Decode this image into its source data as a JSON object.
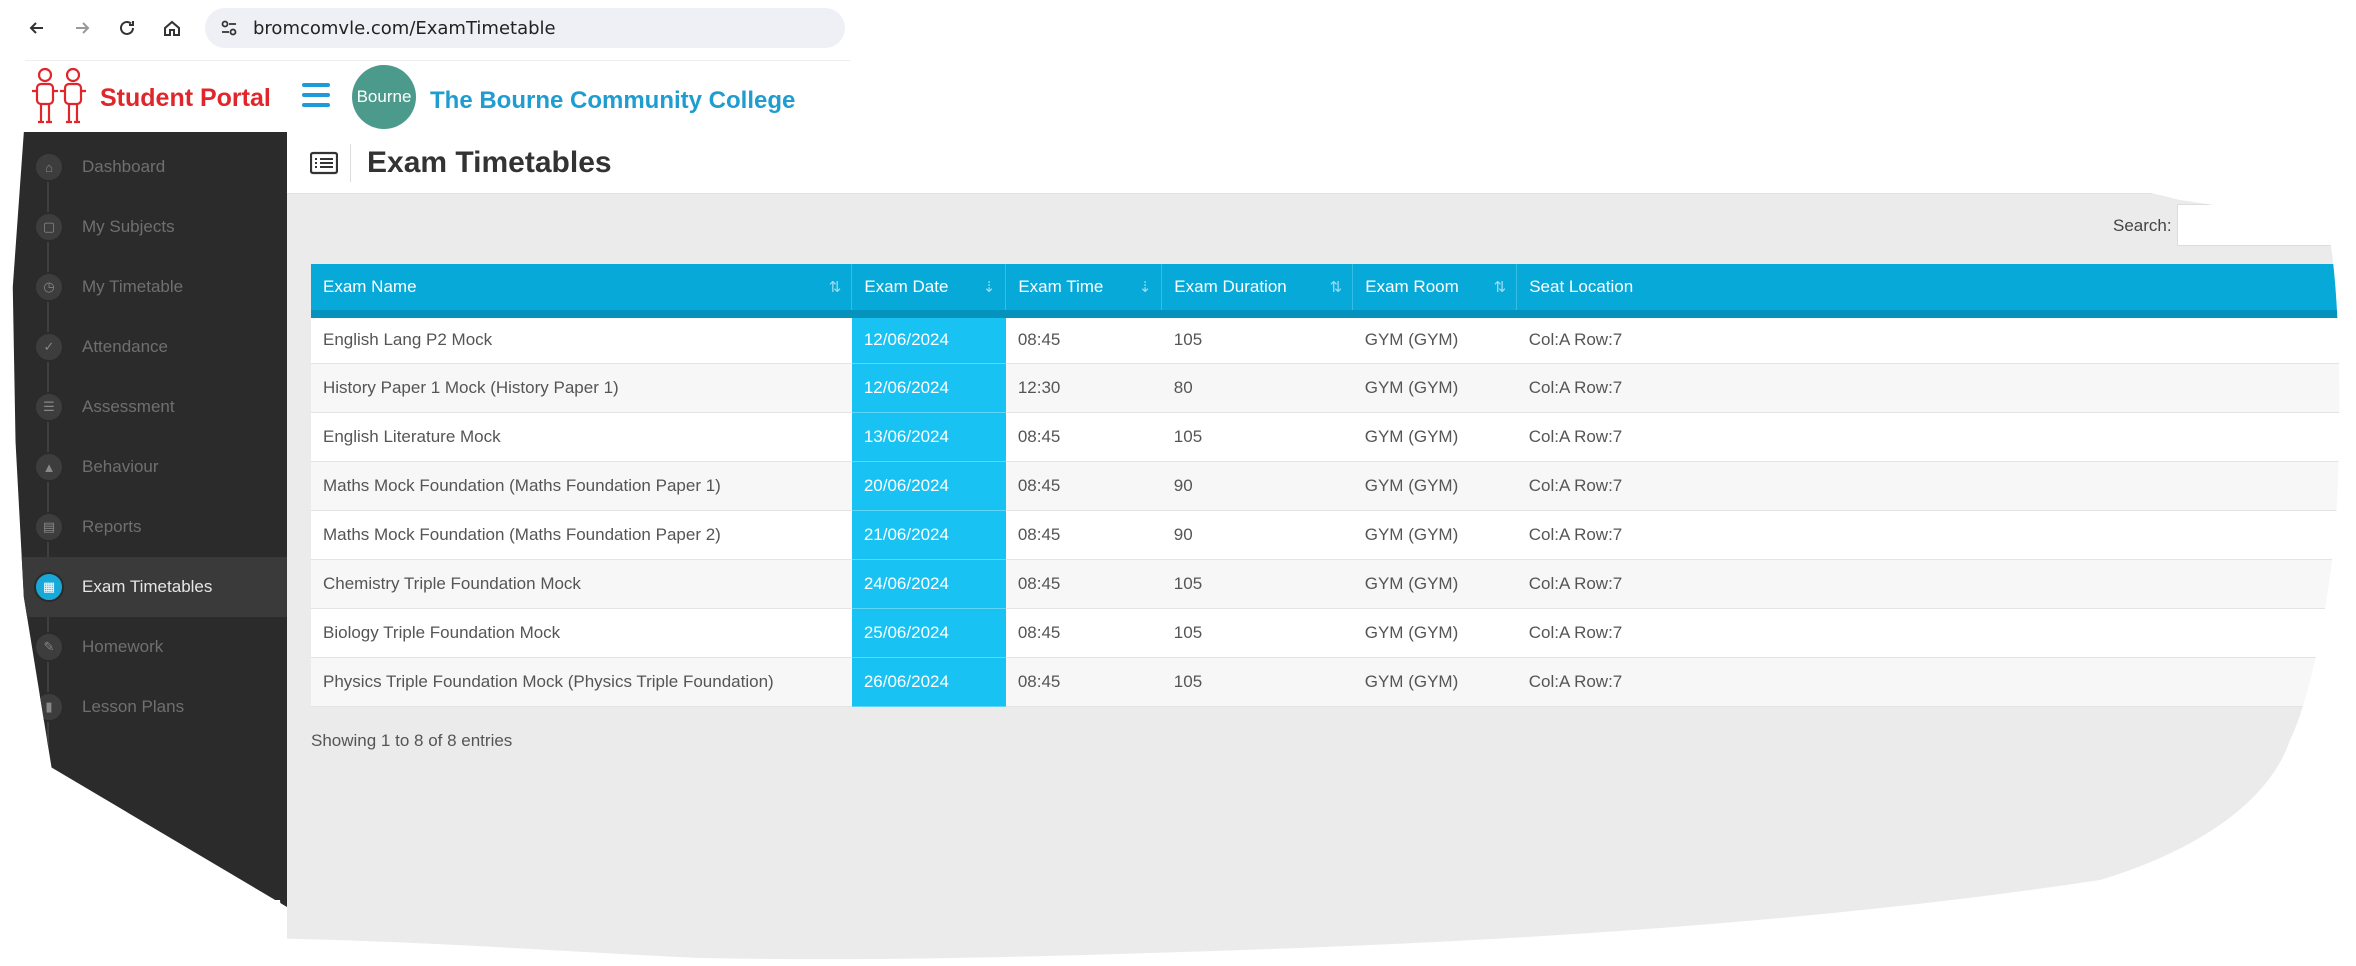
{
  "browser": {
    "url": "bromcomvle.com/ExamTimetable"
  },
  "header": {
    "portal_title": "Student Portal",
    "college_logo_text": "Bourne",
    "college_name": "The Bourne Community College"
  },
  "sidebar": {
    "items": [
      {
        "label": "Dashboard",
        "icon": "home-icon",
        "glyph": "⌂"
      },
      {
        "label": "My Subjects",
        "icon": "document-icon",
        "glyph": "▢"
      },
      {
        "label": "My Timetable",
        "icon": "clock-icon",
        "glyph": "◷"
      },
      {
        "label": "Attendance",
        "icon": "check-icon",
        "glyph": "✓"
      },
      {
        "label": "Assessment",
        "icon": "list-icon",
        "glyph": "☰"
      },
      {
        "label": "Behaviour",
        "icon": "graduation-cap-icon",
        "glyph": "▲"
      },
      {
        "label": "Reports",
        "icon": "report-icon",
        "glyph": "▤"
      },
      {
        "label": "Exam Timetables",
        "icon": "calendar-icon",
        "glyph": "▦"
      },
      {
        "label": "Homework",
        "icon": "pencil-icon",
        "glyph": "✎"
      },
      {
        "label": "Lesson Plans",
        "icon": "book-icon",
        "glyph": "▮"
      }
    ],
    "active_index": 7
  },
  "main": {
    "page_title": "Exam Timetables",
    "search_label": "Search:",
    "columns": [
      "Exam Name",
      "Exam Date",
      "Exam Time",
      "Exam Duration",
      "Exam Room",
      "Seat Location"
    ],
    "rows": [
      [
        "English Lang P2 Mock",
        "12/06/2024",
        "08:45",
        "105",
        "GYM (GYM)",
        "Col:A Row:7"
      ],
      [
        "History Paper 1 Mock (History Paper 1)",
        "12/06/2024",
        "12:30",
        "80",
        "GYM (GYM)",
        "Col:A Row:7"
      ],
      [
        "English Literature Mock",
        "13/06/2024",
        "08:45",
        "105",
        "GYM (GYM)",
        "Col:A Row:7"
      ],
      [
        "Maths Mock Foundation (Maths Foundation Paper 1)",
        "20/06/2024",
        "08:45",
        "90",
        "GYM (GYM)",
        "Col:A Row:7"
      ],
      [
        "Maths Mock Foundation (Maths Foundation Paper 2)",
        "21/06/2024",
        "08:45",
        "90",
        "GYM (GYM)",
        "Col:A Row:7"
      ],
      [
        "Chemistry Triple Foundation Mock",
        "24/06/2024",
        "08:45",
        "105",
        "GYM (GYM)",
        "Col:A Row:7"
      ],
      [
        "Biology Triple Foundation Mock",
        "25/06/2024",
        "08:45",
        "105",
        "GYM (GYM)",
        "Col:A Row:7"
      ],
      [
        "Physics Triple Foundation Mock (Physics Triple Foundation)",
        "26/06/2024",
        "08:45",
        "105",
        "GYM (GYM)",
        "Col:A Row:7"
      ]
    ],
    "footer": "Showing 1 to 8 of 8 entries"
  },
  "colors": {
    "header_blue": "#07a9d9",
    "date_cell": "#18c2f2",
    "portal_red": "#e0262b",
    "sidebar_bg": "#2b2b2b"
  }
}
